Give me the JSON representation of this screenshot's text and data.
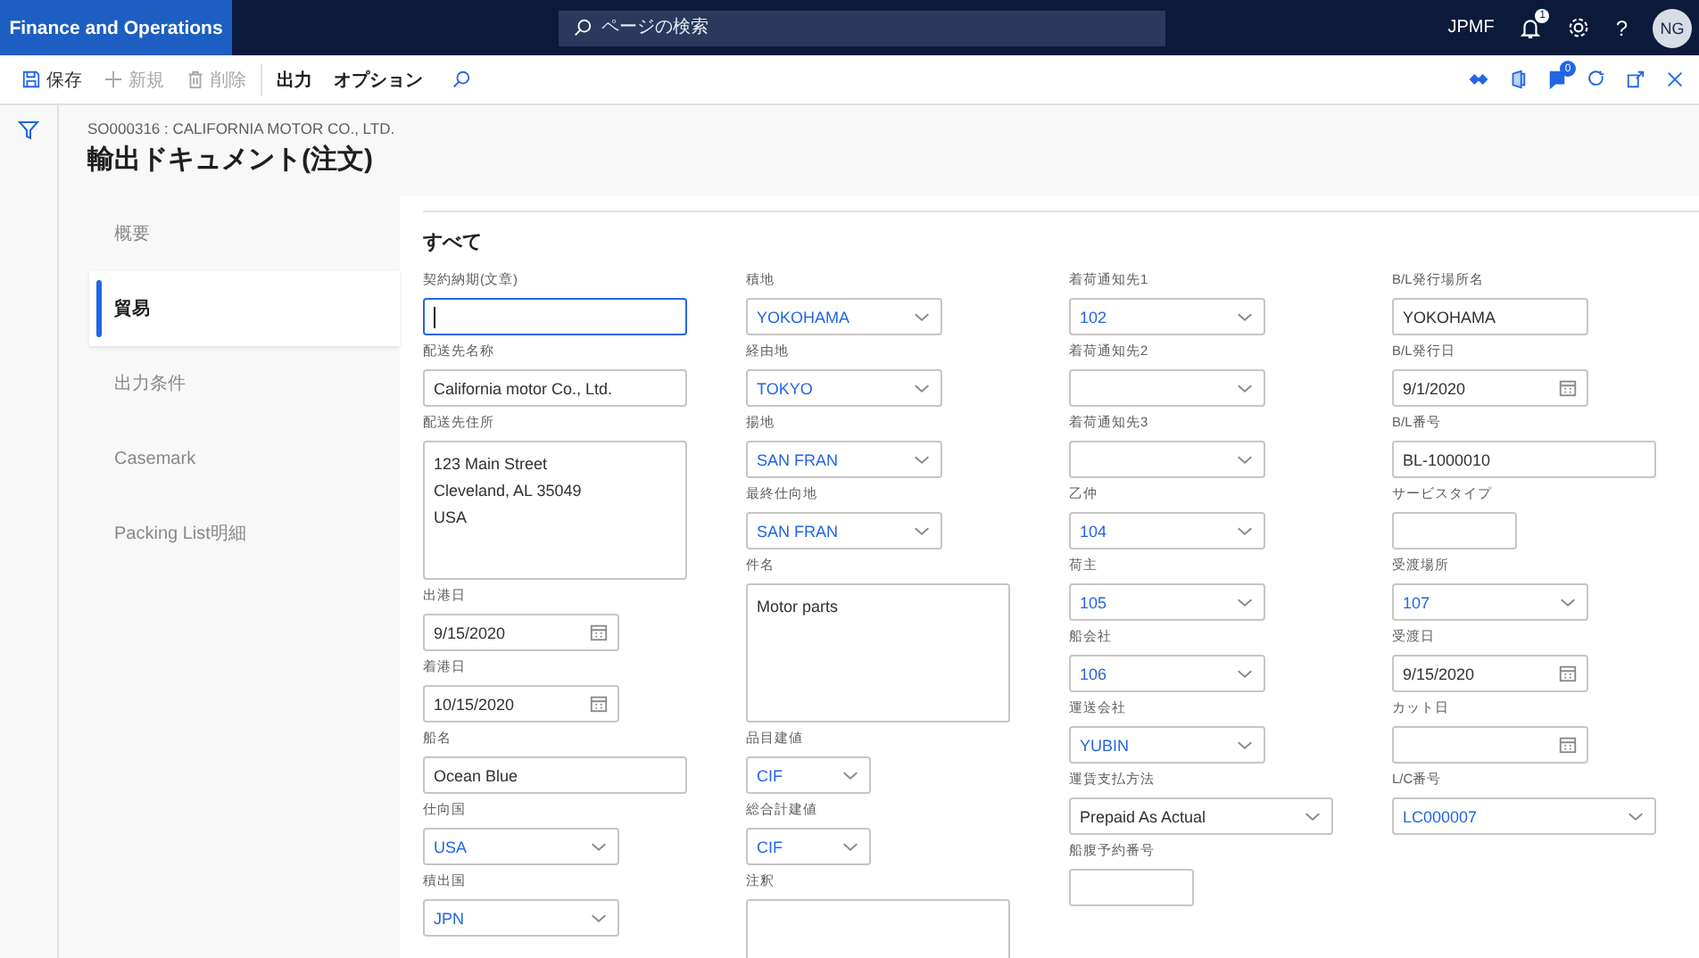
{
  "nav": {
    "app_title": "Finance and Operations",
    "search": {
      "placeholder": "ページの検索"
    },
    "company": "JPMF",
    "notification_badge": "1",
    "help": "?",
    "avatar": "NG"
  },
  "toolbar": {
    "buttons": [
      {
        "kind": "save",
        "label": "保存",
        "disabled": false
      },
      {
        "kind": "add",
        "label": "新規",
        "disabled": true
      },
      {
        "kind": "delete",
        "label": "削除",
        "disabled": true
      },
      {
        "kind": "menu",
        "label": "出力",
        "disabled": false
      },
      {
        "kind": "menu",
        "label": "オプション",
        "disabled": false
      }
    ],
    "chat_badge": "0"
  },
  "header": {
    "record": "SO000316 : CALIFORNIA MOTOR CO., LTD.",
    "title": "輸出ドキュメント(注文)"
  },
  "tabs": [
    {
      "label": "概要",
      "selected": false
    },
    {
      "label": "貿易",
      "selected": true
    },
    {
      "label": "出力条件",
      "selected": false
    },
    {
      "label": "Casemark",
      "selected": false
    },
    {
      "label": "Packing List明細",
      "selected": false
    }
  ],
  "section_title": "すべて",
  "columns": [
    [
      {
        "label": "契約納期(文章)",
        "kind": "text-wide",
        "focused": true
      },
      {
        "label": "配送先名称",
        "kind": "text-wide",
        "value": "California motor Co., Ltd.",
        "focused": false
      },
      {
        "label": "配送先住所",
        "kind": "textarea",
        "value": "123 Main Street\nCleveland, AL 35049\nUSA",
        "focused": false
      },
      {
        "label": "出港日",
        "kind": "date",
        "value": "9/15/2020",
        "focused": false
      },
      {
        "label": "着港日",
        "kind": "date",
        "value": "10/15/2020",
        "focused": false
      },
      {
        "label": "船名",
        "kind": "text-wide",
        "value": "Ocean Blue",
        "focused": false
      },
      {
        "label": "仕向国",
        "kind": "select",
        "value": "USA",
        "focused": false
      },
      {
        "label": "積出国",
        "kind": "select",
        "value": "JPN",
        "focused": false
      }
    ],
    [
      {
        "label": "積地",
        "kind": "select",
        "value": "YOKOHAMA",
        "focused": false
      },
      {
        "label": "経由地",
        "kind": "select",
        "value": "TOKYO",
        "focused": false
      },
      {
        "label": "揚地",
        "kind": "select",
        "value": "SAN FRAN",
        "focused": false
      },
      {
        "label": "最終仕向地",
        "kind": "select",
        "value": "SAN FRAN",
        "focused": false
      },
      {
        "label": "件名",
        "kind": "textarea",
        "value": "Motor parts",
        "focused": false
      },
      {
        "label": "品目建値",
        "kind": "select-short",
        "value": "CIF",
        "focused": false
      },
      {
        "label": "総合計建値",
        "kind": "select-short",
        "value": "CIF",
        "focused": false
      },
      {
        "label": "注釈",
        "kind": "textarea",
        "focused": false
      }
    ],
    [
      {
        "label": "着荷通知先1",
        "kind": "select",
        "value": "102",
        "focused": false
      },
      {
        "label": "着荷通知先2",
        "kind": "select",
        "focused": false
      },
      {
        "label": "着荷通知先3",
        "kind": "select",
        "focused": false
      },
      {
        "label": "乙仲",
        "kind": "select",
        "value": "104",
        "focused": false
      },
      {
        "label": "荷主",
        "kind": "select",
        "value": "105",
        "focused": false
      },
      {
        "label": "船会社",
        "kind": "select",
        "value": "106",
        "focused": false
      },
      {
        "label": "運送会社",
        "kind": "select",
        "value": "YUBIN",
        "focused": false
      },
      {
        "label": "運賃支払方法",
        "kind": "enum-wide",
        "value": "Prepaid As Actual",
        "focused": false
      },
      {
        "label": "船腹予約番号",
        "kind": "text-short",
        "focused": false
      }
    ],
    [
      {
        "label": "B/L発行場所名",
        "kind": "text",
        "value": "YOKOHAMA",
        "focused": false
      },
      {
        "label": "B/L発行日",
        "kind": "date",
        "value": "9/1/2020",
        "focused": false
      },
      {
        "label": "B/L番号",
        "kind": "text-wide",
        "value": "BL-1000010",
        "focused": false
      },
      {
        "label": "サービスタイプ",
        "kind": "text-short",
        "focused": false
      },
      {
        "label": "受渡場所",
        "kind": "select",
        "value": "107",
        "focused": false
      },
      {
        "label": "受渡日",
        "kind": "date",
        "value": "9/15/2020",
        "focused": false
      },
      {
        "label": "カット日",
        "kind": "date",
        "focused": false
      },
      {
        "label": "L/C番号",
        "kind": "select-wide",
        "value": "LC000007",
        "focused": false
      }
    ]
  ]
}
